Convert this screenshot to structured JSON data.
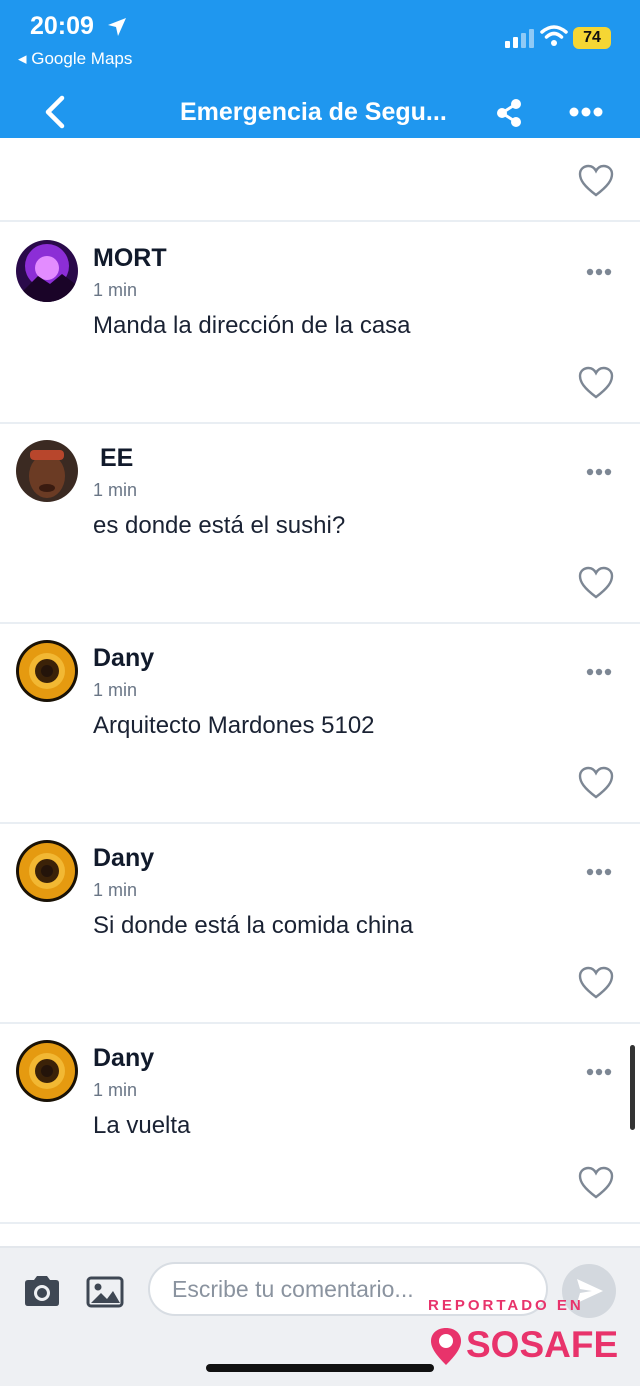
{
  "status_bar": {
    "time": "20:09",
    "back_app": "◂ Google Maps",
    "battery": "74"
  },
  "header": {
    "title": "Emergencia de Segu..."
  },
  "comments": [
    {
      "author": "MORT",
      "time": "1 min",
      "text": "Manda la dirección de la casa",
      "avatar": "purple-storm"
    },
    {
      "author": " EE",
      "time": "1 min",
      "text": "es donde está el sushi?",
      "avatar": "portrait"
    },
    {
      "author": "Dany",
      "time": "1 min",
      "text": "Arquitecto Mardones 5102",
      "avatar": "sunflower"
    },
    {
      "author": "Dany",
      "time": "1 min",
      "text": "Si donde está la comida china",
      "avatar": "sunflower"
    },
    {
      "author": "Dany",
      "time": "1 min",
      "text": "La vuelta",
      "avatar": "sunflower"
    }
  ],
  "composer": {
    "placeholder": "Escribe tu comentario..."
  },
  "watermark": {
    "reported": "REPORTADO EN",
    "brand": "SOSAFE"
  },
  "colors": {
    "header_bg": "#1f97ef",
    "brand_pink": "#e8336b"
  }
}
